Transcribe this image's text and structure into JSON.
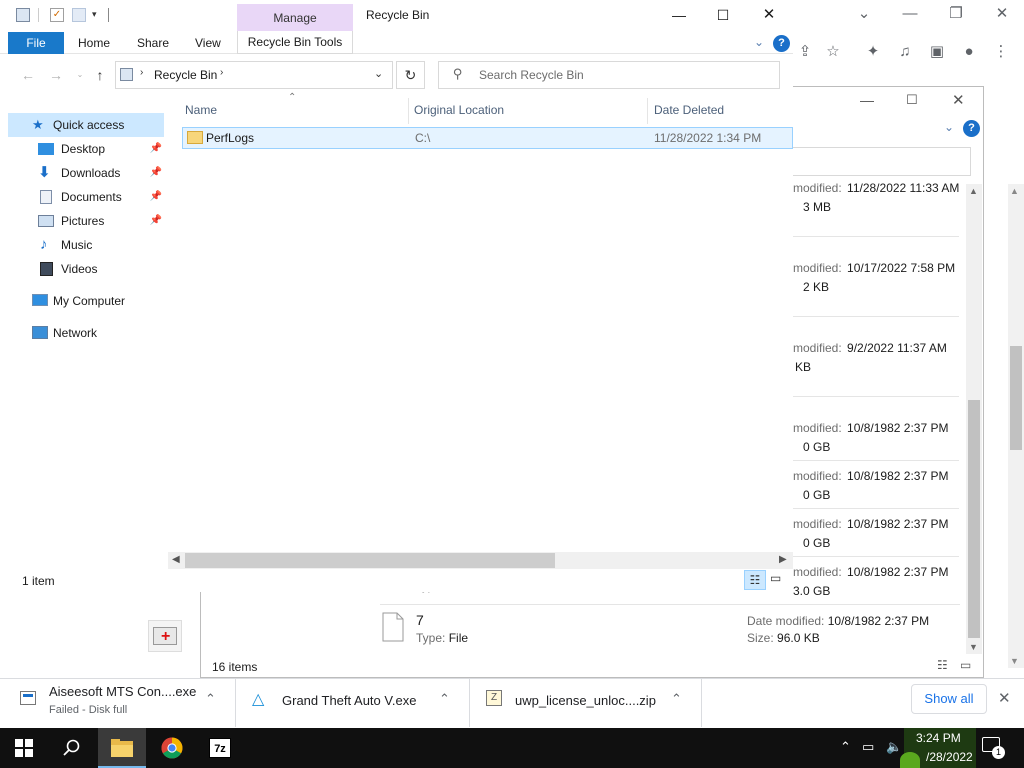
{
  "explorer": {
    "title": "Recycle Bin",
    "manage_tab": "Manage",
    "tabs": {
      "file": "File",
      "home": "Home",
      "share": "Share",
      "view": "View",
      "tools": "Recycle Bin Tools"
    },
    "address": {
      "path": "Recycle Bin"
    },
    "search": {
      "placeholder": "Search Recycle Bin"
    },
    "columns": {
      "name": "Name",
      "original_location": "Original Location",
      "date_deleted": "Date Deleted"
    },
    "files": [
      {
        "name": "PerfLogs",
        "original_location": "C:\\",
        "date_deleted": "11/28/2022 1:34 PM"
      }
    ],
    "nav": {
      "quick_access": "Quick access",
      "items": [
        {
          "label": "Desktop",
          "icon": "desktop-icon",
          "pinned": true
        },
        {
          "label": "Downloads",
          "icon": "downloads-icon",
          "pinned": true
        },
        {
          "label": "Documents",
          "icon": "documents-icon",
          "pinned": true
        },
        {
          "label": "Pictures",
          "icon": "pictures-icon",
          "pinned": true
        },
        {
          "label": "Music",
          "icon": "music-icon",
          "pinned": false
        },
        {
          "label": "Videos",
          "icon": "videos-icon",
          "pinned": false
        }
      ],
      "my_computer": "My Computer",
      "network": "Network"
    },
    "status": {
      "items": "1 item"
    }
  },
  "explorer2": {
    "entries": [
      {
        "modified_label": "modified:",
        "modified": "11/28/2022 11:33 AM",
        "size": "3 MB"
      },
      {
        "modified_label": "modified:",
        "modified": "10/17/2022 7:58 PM",
        "size": "2 KB"
      },
      {
        "modified_label": "modified:",
        "modified": "9/2/2022 11:37 AM",
        "size": "KB"
      },
      {
        "modified_label": "modified:",
        "modified": "10/8/1982 2:37 PM",
        "size": "0 GB"
      },
      {
        "modified_label": "modified:",
        "modified": "10/8/1982 2:37 PM",
        "size": "0 GB"
      },
      {
        "modified_label": "modified:",
        "modified": "10/8/1982 2:37 PM",
        "size": "0 GB"
      },
      {
        "modified_label": "modified:",
        "modified": "10/8/1982 2:37 PM",
        "size": "3.0 GB"
      }
    ],
    "last_item": {
      "name": "7",
      "type_label": "Type:",
      "type": "File",
      "modified_label": "Date modified:",
      "modified": "10/8/1982 2:37 PM",
      "size_label": "Size:",
      "size": "96.0 KB"
    },
    "partial_type": "Type: File",
    "status": "16 items"
  },
  "downloads": {
    "items": [
      {
        "name": "Aiseesoft MTS Con....exe",
        "status": "Failed - Disk full"
      },
      {
        "name": "Grand Theft Auto V.exe",
        "status": ""
      },
      {
        "name": "uwp_license_unloc....zip",
        "status": ""
      }
    ],
    "show_all": "Show all"
  },
  "taskbar": {
    "time": "3:24 PM",
    "date": "/28/2022",
    "notification_count": "1"
  },
  "colors": {
    "accent": "#1979ca",
    "manage_tab": "#e9d7f7",
    "selection": "#e5f3ff",
    "taskbar": "#101010"
  }
}
